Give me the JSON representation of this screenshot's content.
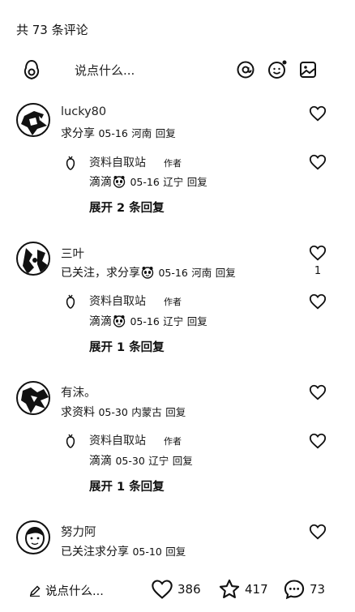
{
  "header": {
    "title": "共 73 条评论"
  },
  "composer": {
    "placeholder": "说点什么..."
  },
  "comments": [
    {
      "name": "lucky80",
      "prefix": "求分享",
      "date": "05-16",
      "location": "河南",
      "reply": "回复",
      "like_count": "",
      "replies": [
        {
          "name": "资料自取站",
          "tag": "作者",
          "text": "滴滴",
          "date": "05-16",
          "location": "辽宁",
          "reply": "回复"
        }
      ],
      "expand": "展开 2 条回复"
    },
    {
      "name": "三叶",
      "prefix": "已关注，求分享",
      "date": "05-16",
      "location": "河南",
      "reply": "回复",
      "like_count": "1",
      "replies": [
        {
          "name": "资料自取站",
          "tag": "作者",
          "text": "滴滴",
          "date": "05-16",
          "location": "辽宁",
          "reply": "回复"
        }
      ],
      "expand": "展开 1 条回复"
    },
    {
      "name": "有沫。",
      "prefix": "求资料",
      "date": "05-30",
      "location": "内蒙古",
      "reply": "回复",
      "like_count": "",
      "replies": [
        {
          "name": "资料自取站",
          "tag": "作者",
          "text": "滴滴",
          "date": "05-30",
          "location": "辽宁",
          "reply": "回复"
        }
      ],
      "expand": "展开 1 条回复"
    },
    {
      "name": "努力阿",
      "prefix": "已关注求分享",
      "date": "05-10",
      "location": "",
      "reply": "回复",
      "like_count": ""
    }
  ],
  "bottom": {
    "write_label": "说点什么...",
    "likes": "386",
    "stars": "417",
    "comments": "73"
  }
}
